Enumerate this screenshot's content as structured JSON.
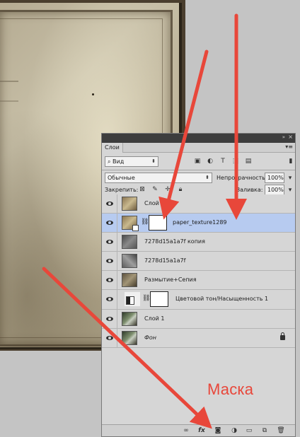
{
  "panel": {
    "tab_label": "Слои",
    "collapse_glyph": "»",
    "close_glyph": "×",
    "menu_glyph": "▾≡"
  },
  "filter": {
    "kind_label": "Вид",
    "kind_icon": "search-icon"
  },
  "blend": {
    "mode": "Обычные",
    "opacity_label": "Непрозрачность:",
    "opacity_value": "100%",
    "lock_label": "Закрепить:",
    "fill_label": "Заливка:",
    "fill_value": "100%"
  },
  "layers": [
    {
      "name": "Слой 2",
      "thumb": "paper",
      "visible": true,
      "selected": false
    },
    {
      "name": "paper_texture1289",
      "thumb": "paper",
      "visible": true,
      "selected": true,
      "has_mask": true,
      "smart_object": true
    },
    {
      "name": "7278d15a1a7f копия",
      "thumb": "gray",
      "visible": true,
      "selected": false
    },
    {
      "name": "7278d15a1a7f",
      "thumb": "gray2",
      "visible": true,
      "selected": false
    },
    {
      "name": "Размытие+Сепия",
      "thumb": "sepia",
      "visible": true,
      "selected": false
    },
    {
      "name": "Цветовой тон/Насыщенность 1",
      "thumb": "adjustment",
      "visible": true,
      "selected": false,
      "has_mask": true
    },
    {
      "name": "Слой 1",
      "thumb": "photo",
      "visible": true,
      "selected": false
    },
    {
      "name": "Фон",
      "thumb": "photo",
      "visible": true,
      "selected": false,
      "locked": true,
      "italic": true
    }
  ],
  "bottom_icons": [
    "link-icon",
    "fx-icon",
    "add-mask-icon",
    "adjustment-icon",
    "group-folder-icon",
    "new-layer-icon",
    "trash-icon"
  ],
  "bottom_fx_label": "fx",
  "annotation": {
    "label": "Маска",
    "color": "#e8473a"
  }
}
